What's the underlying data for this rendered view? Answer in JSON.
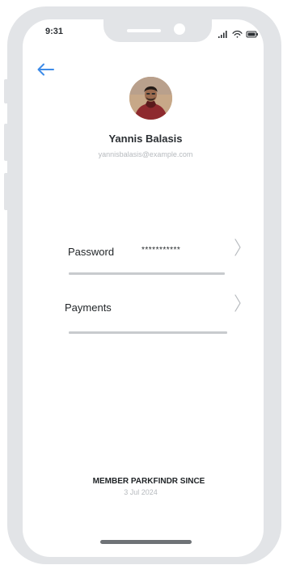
{
  "status_bar": {
    "time": "9:31",
    "icons": [
      "signal-icon",
      "wifi-icon",
      "battery-icon"
    ]
  },
  "profile": {
    "name": "Yannis Balasis",
    "email": "yannisbalasis@example.com"
  },
  "settings": {
    "password": {
      "label": "Password",
      "value": "***********"
    },
    "payments": {
      "label": "Payments"
    }
  },
  "member": {
    "label": "MEMBER PARKFINDR SINCE",
    "date": "3 Jul 2024"
  },
  "colors": {
    "accent": "#3d8be8",
    "frame": "#e2e4e7",
    "text": "#1f2326",
    "muted": "#b6babe",
    "divider": "#c8cbce"
  }
}
